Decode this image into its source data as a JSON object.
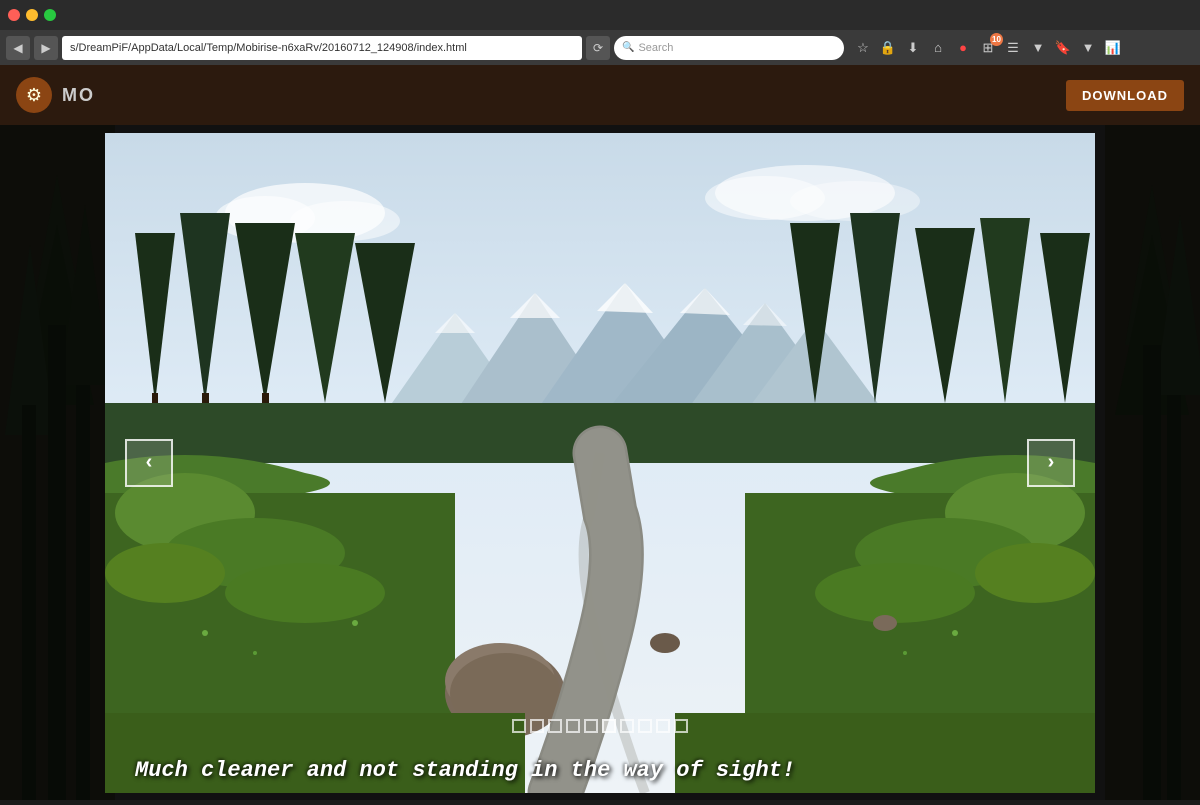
{
  "browser": {
    "address": "s/DreamPiF/AppData/Local/Temp/Mobirise-n6xaRv/20160712_124908/index.html",
    "search_placeholder": "Search",
    "reload_label": "⟳",
    "notification_count": "10"
  },
  "app": {
    "title": "MO",
    "download_label": "DOWNLOAD"
  },
  "carousel": {
    "caption": "Much cleaner and not standing in the way of sight!",
    "prev_arrow": "‹",
    "next_arrow": "›",
    "dots": [
      {
        "active": false
      },
      {
        "active": false
      },
      {
        "active": false
      },
      {
        "active": false
      },
      {
        "active": false
      },
      {
        "active": true
      },
      {
        "active": false
      },
      {
        "active": false
      },
      {
        "active": false
      },
      {
        "active": false
      }
    ]
  }
}
